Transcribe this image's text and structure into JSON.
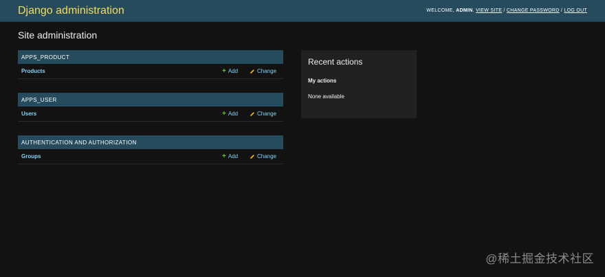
{
  "header": {
    "brand": "Django administration",
    "user_tools": {
      "welcome": "WELCOME,",
      "username": "ADMIN",
      "view_site": "VIEW SITE",
      "sep1": "/",
      "change_password": "CHANGE PASSWORD",
      "sep2": "/",
      "log_out": "LOG OUT"
    }
  },
  "page": {
    "title": "Site administration"
  },
  "modules": [
    {
      "caption": "APPS_PRODUCT",
      "model": "Products",
      "add": "Add",
      "change": "Change"
    },
    {
      "caption": "APPS_USER",
      "model": "Users",
      "add": "Add",
      "change": "Change"
    },
    {
      "caption": "AUTHENTICATION AND AUTHORIZATION",
      "model": "Groups",
      "add": "Add",
      "change": "Change"
    }
  ],
  "recent_actions": {
    "title": "Recent actions",
    "my_actions": "My actions",
    "empty": "None available"
  },
  "watermark": "@稀土掘金技术社区",
  "icons": {
    "add": "plus-icon",
    "change": "pencil-icon"
  },
  "colors": {
    "header_bg": "#264b5d",
    "brand": "#f5dd5d",
    "link": "#81d4fa",
    "add_icon": "#70bf2b",
    "change_icon": "#efb80b",
    "page_bg": "#121212",
    "panel_bg": "#212121"
  }
}
